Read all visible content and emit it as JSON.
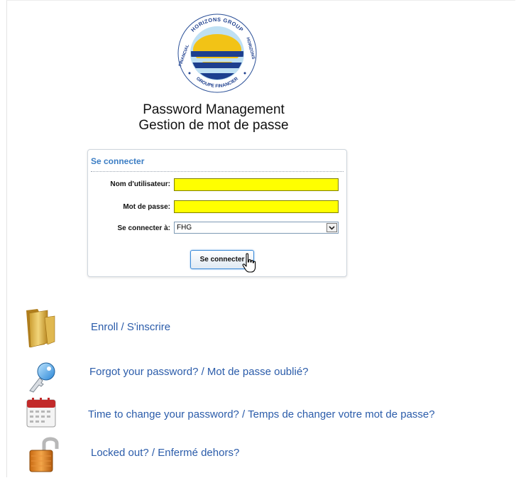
{
  "logo": {
    "top_text": "HORIZONS GROUP",
    "left_text": "FINANCIAL",
    "right_text": "HORIZONS",
    "bottom_text": "GROUPE FINANCIER",
    "colors": {
      "sun": "#f2c316",
      "sea": "#1d3f8e",
      "sky": "#bfe0f3"
    }
  },
  "header": {
    "title_en": "Password Management",
    "title_fr": "Gestion de mot de passe"
  },
  "login": {
    "panel_title": "Se connecter",
    "username_label": "Nom d'utilisateur:",
    "username_value": "",
    "password_label": "Mot de passe:",
    "password_value": "",
    "domain_label": "Se connecter à:",
    "domain_selected": "FHG",
    "submit_label": "Se connecter"
  },
  "links": [
    {
      "label": "Enroll / S'inscrire",
      "icon": "folder-icon"
    },
    {
      "label": "Forgot your password? / Mot de passe oublié?",
      "icon": "key-icon"
    },
    {
      "label": "Time to change your password?  / Temps de changer votre mot de passe?",
      "icon": "calendar-icon"
    },
    {
      "label": "Locked out? / Enfermé dehors?",
      "icon": "open-padlock-icon"
    }
  ],
  "colors": {
    "link": "#2b5caa",
    "panel_title": "#3b7dc4",
    "input_highlight": "#ffff00"
  }
}
